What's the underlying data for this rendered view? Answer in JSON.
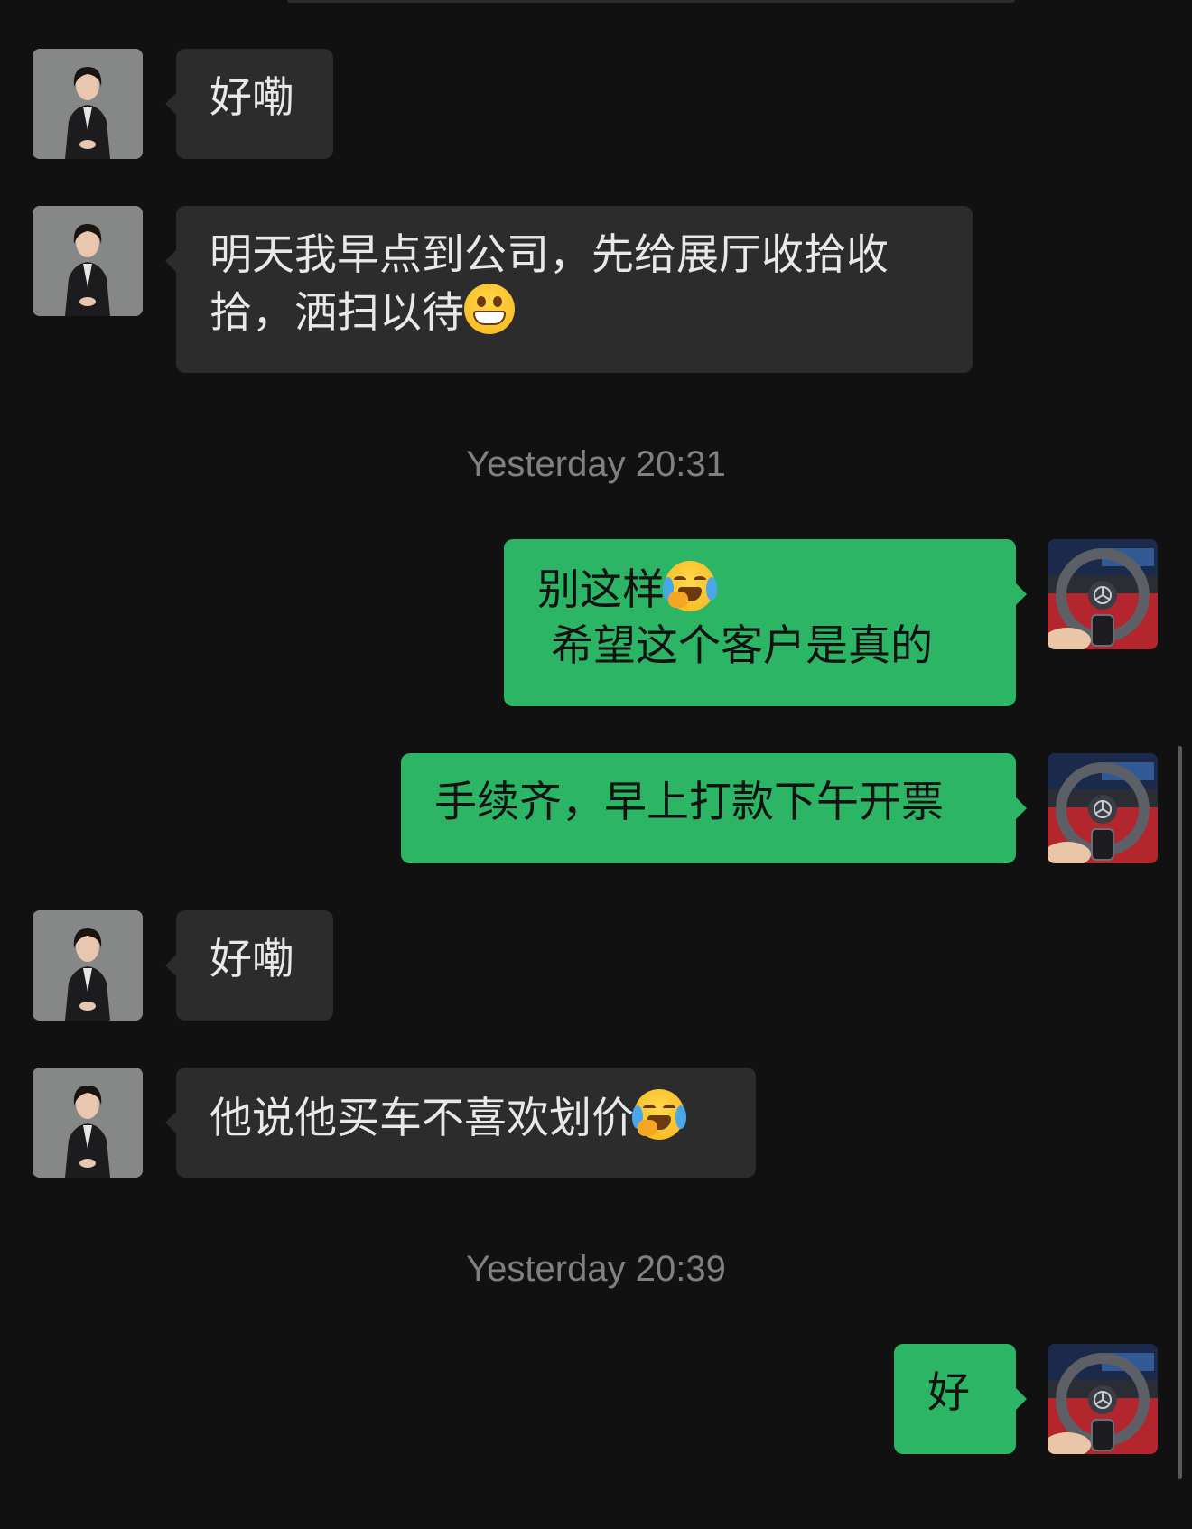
{
  "messages": [
    {
      "text_lines": [
        "好嘞"
      ]
    },
    {
      "text_lines": [
        "明天我早点到公司，先给展厅收拾收",
        "拾，洒扫以待"
      ]
    },
    {
      "text_lines": [
        "别这样",
        " 希望这个客户是真的"
      ]
    },
    {
      "text_lines": [
        "手续齐，早上打款下午开票"
      ]
    },
    {
      "text_lines": [
        "好嘞"
      ]
    },
    {
      "text_lines": [
        "他说他买车不喜欢划价"
      ]
    },
    {
      "text_lines": [
        "好"
      ]
    }
  ],
  "timestamps": [
    "Yesterday 20:31",
    "Yesterday 20:39"
  ],
  "colors": {
    "background": "#111111",
    "incoming_bubble": "#2c2c2c",
    "outgoing_bubble": "#2bb564",
    "timestamp": "#808080"
  },
  "emojis": [
    "grinning-face",
    "loudly-crying-face"
  ]
}
